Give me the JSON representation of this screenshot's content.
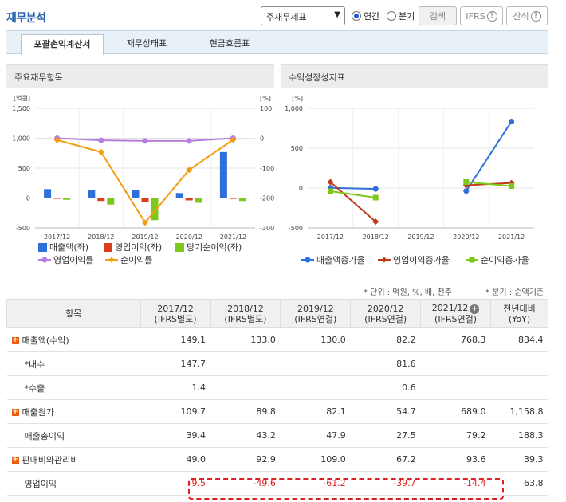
{
  "header": {
    "title": "재무분석",
    "select_value": "주재무제표",
    "radio_annual": "연간",
    "radio_quarter": "분기",
    "search_btn": "검색",
    "ifrs_btn": "IFRS",
    "formula_btn": "산식"
  },
  "tabs": [
    "포괄손익계산서",
    "재무상태표",
    "현금흐름표"
  ],
  "panels": {
    "left_title": "주요재무항목",
    "right_title": "수익성장성지표"
  },
  "chart_data": [
    {
      "type": "bar",
      "title": "주요재무항목",
      "categories": [
        "2017/12",
        "2018/12",
        "2019/12",
        "2020/12",
        "2021/12"
      ],
      "ylabel_left": "[억원]",
      "ylabel_right": "[%]",
      "ylim_left": [
        -500,
        1500
      ],
      "ylim_right": [
        -300,
        100
      ],
      "left_ticks": [
        "1,500",
        "1,000",
        "500",
        "0",
        "-500"
      ],
      "right_ticks": [
        "100",
        "0",
        "-100",
        "-200",
        "-300"
      ],
      "series": [
        {
          "name": "매출액(좌)",
          "axis": "left",
          "kind": "bar",
          "color": "#2f6fdc",
          "values": [
            149.1,
            133.0,
            130.0,
            82.2,
            768.3
          ]
        },
        {
          "name": "영업이익(좌)",
          "axis": "left",
          "kind": "bar",
          "color": "#d9401a",
          "values": [
            -9.5,
            -49.6,
            -61.2,
            -39.7,
            -14.4
          ]
        },
        {
          "name": "당기순이익(좌)",
          "axis": "left",
          "kind": "bar",
          "color": "#7ec81e",
          "values": [
            -30,
            -110,
            -370,
            -80,
            -50
          ]
        },
        {
          "name": "영업이익률",
          "axis": "right",
          "kind": "line",
          "color": "#b57fe0",
          "values": [
            0,
            -7,
            -9,
            -9,
            0
          ]
        },
        {
          "name": "순이익률",
          "axis": "right",
          "kind": "line",
          "color": "#f39c12",
          "values": [
            -6,
            -46,
            -282,
            -106,
            -5
          ]
        }
      ]
    },
    {
      "type": "line",
      "title": "수익성장성지표",
      "categories": [
        "2017/12",
        "2018/12",
        "2019/12",
        "2020/12",
        "2021/12"
      ],
      "ylabel": "[%]",
      "ylim": [
        -500,
        1000
      ],
      "ticks": [
        "1,000",
        "500",
        "0",
        "-500"
      ],
      "series": [
        {
          "name": "매출액증가율",
          "color": "#2f6fdc",
          "marker": "circle",
          "values": [
            3,
            -11,
            null,
            -37,
            835
          ]
        },
        {
          "name": "영업이익증가율",
          "color": "#c0391a",
          "marker": "diamond",
          "values": [
            75,
            -421,
            null,
            35,
            64
          ]
        },
        {
          "name": "순이익증가율",
          "color": "#7ec81e",
          "marker": "square",
          "values": [
            -40,
            -120,
            null,
            75,
            25
          ]
        }
      ]
    }
  ],
  "notes": {
    "unit": "* 단위 : 억원, %, 배, 천주",
    "quarter": "* 분기 : 순액기준"
  },
  "table": {
    "header_item": "항목",
    "columns": [
      {
        "year": "2017/12",
        "basis": "(IFRS별도)"
      },
      {
        "year": "2018/12",
        "basis": "(IFRS별도)"
      },
      {
        "year": "2019/12",
        "basis": "(IFRS연결)"
      },
      {
        "year": "2020/12",
        "basis": "(IFRS연결)"
      },
      {
        "year": "2021/12",
        "basis": "(IFRS연결)"
      }
    ],
    "yoy_header": {
      "line1": "전년대비",
      "line2": "(YoY)"
    },
    "rows": [
      {
        "label": "매출액(수익)",
        "expand": true,
        "values": [
          "149.1",
          "133.0",
          "130.0",
          "82.2",
          "768.3"
        ],
        "yoy": "834.4"
      },
      {
        "label": "*내수",
        "expand": false,
        "values": [
          "147.7",
          "",
          "",
          "81.6",
          ""
        ],
        "yoy": ""
      },
      {
        "label": "*수출",
        "expand": false,
        "values": [
          "1.4",
          "",
          "",
          "0.6",
          ""
        ],
        "yoy": ""
      },
      {
        "label": "매출원가",
        "expand": true,
        "values": [
          "109.7",
          "89.8",
          "82.1",
          "54.7",
          "689.0"
        ],
        "yoy": "1,158.8"
      },
      {
        "label": "매출총이익",
        "expand": false,
        "values": [
          "39.4",
          "43.2",
          "47.9",
          "27.5",
          "79.2"
        ],
        "yoy": "188.3"
      },
      {
        "label": "판매비와관리비",
        "expand": true,
        "values": [
          "49.0",
          "92.9",
          "109.0",
          "67.2",
          "93.6"
        ],
        "yoy": "39.3"
      },
      {
        "label": "영업이익",
        "expand": false,
        "negative": true,
        "values": [
          "-9.5",
          "-49.6",
          "-61.2",
          "-39.7",
          "-14.4"
        ],
        "yoy": "63.8"
      }
    ]
  },
  "colors": {
    "accent": "#2a63b0",
    "negative": "#e01e1e",
    "highlight_border": "#e01e1e"
  }
}
